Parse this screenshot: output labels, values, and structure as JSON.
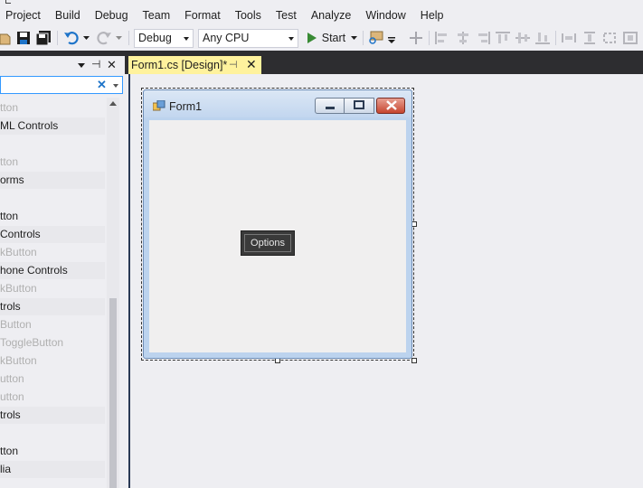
{
  "menu": [
    "Project",
    "Build",
    "Debug",
    "Team",
    "Format",
    "Tools",
    "Test",
    "Analyze",
    "Window",
    "Help"
  ],
  "toolbar": {
    "config_value": "Debug",
    "platform_value": "Any CPU",
    "start_label": "Start",
    "colors": {
      "start_green": "#388a34",
      "undo_blue": "#1e74c9"
    }
  },
  "document_tab": {
    "label": "Form1.cs [Design]*",
    "pin_glyph": "⊣",
    "close_glyph": "✕",
    "color": "#fff29d"
  },
  "toolbox": {
    "header_pin": "⊣",
    "header_close": "✕",
    "search_clear": "✕",
    "items": [
      {
        "label": "tton",
        "style": "dim"
      },
      {
        "label": "ML Controls",
        "style": "cat"
      },
      {
        "label": "",
        "style": "plain"
      },
      {
        "label": "tton",
        "style": "dim"
      },
      {
        "label": "orms",
        "style": "cat"
      },
      {
        "label": "",
        "style": "plain"
      },
      {
        "label": "tton",
        "style": "plain"
      },
      {
        "label": "Controls",
        "style": "cat"
      },
      {
        "label": "kButton",
        "style": "dim"
      },
      {
        "label": "hone Controls",
        "style": "cat"
      },
      {
        "label": "kButton",
        "style": "dim"
      },
      {
        "label": "trols",
        "style": "cat"
      },
      {
        "label": "Button",
        "style": "dim"
      },
      {
        "label": "ToggleButton",
        "style": "dim"
      },
      {
        "label": "kButton",
        "style": "dim"
      },
      {
        "label": "utton",
        "style": "dim"
      },
      {
        "label": "utton",
        "style": "dim"
      },
      {
        "label": "trols",
        "style": "cat"
      },
      {
        "label": "",
        "style": "plain"
      },
      {
        "label": "tton",
        "style": "plain"
      },
      {
        "label": "lia",
        "style": "cat"
      }
    ]
  },
  "form": {
    "title": "Form1",
    "options_button_label": "Options"
  }
}
